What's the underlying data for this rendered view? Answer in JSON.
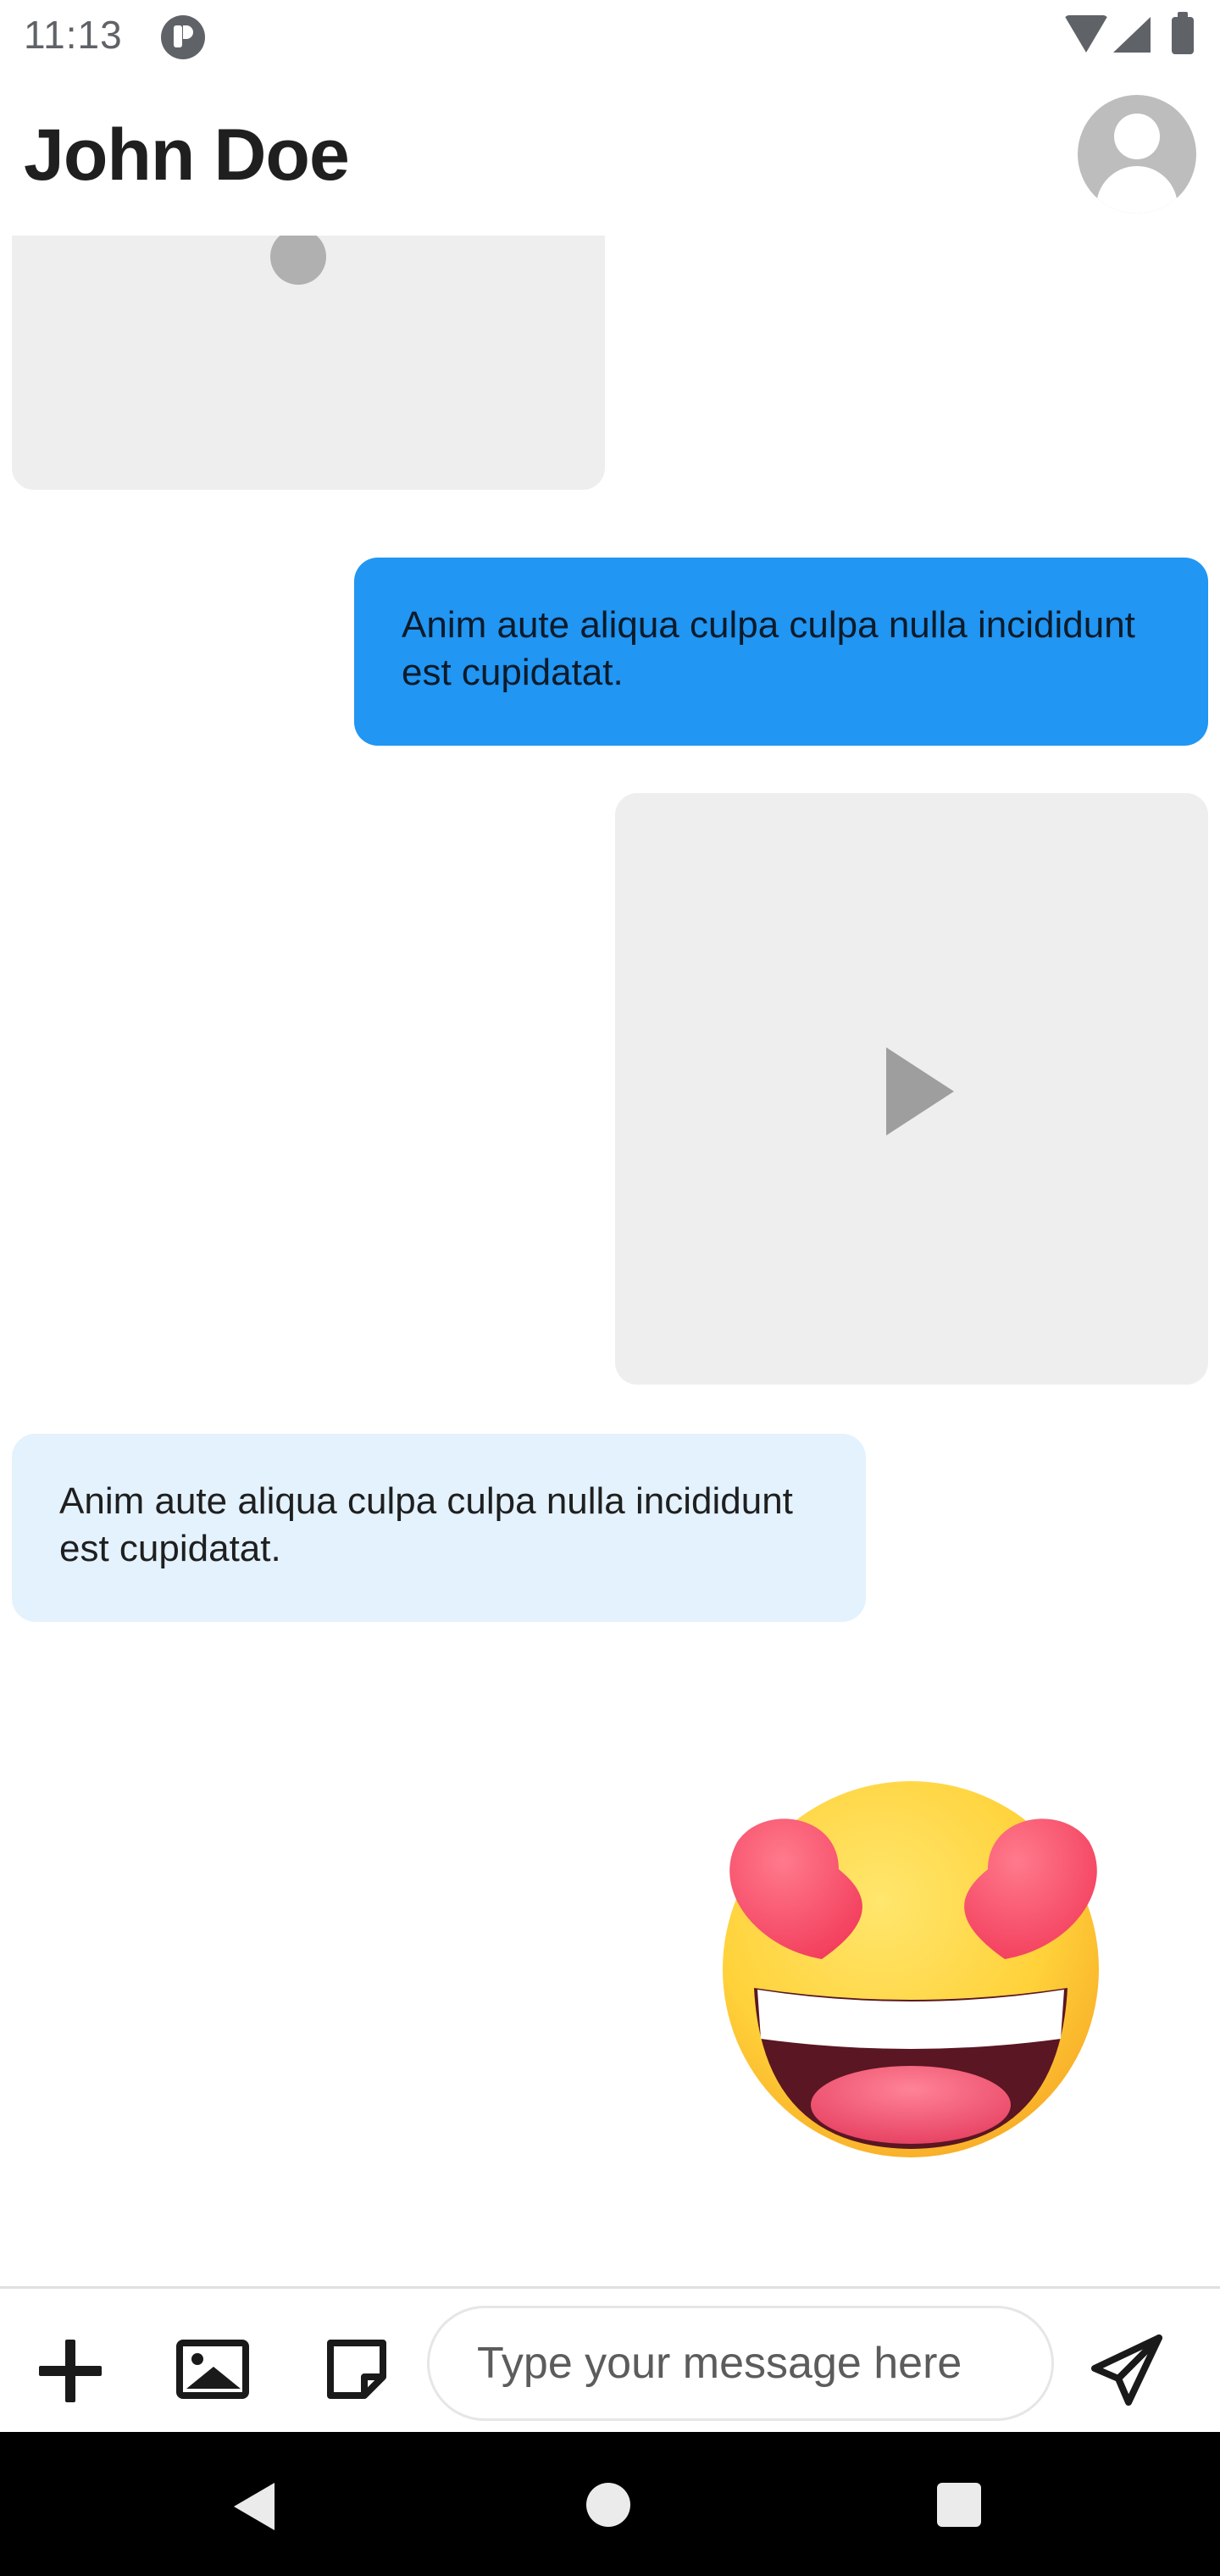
{
  "status_bar": {
    "time": "11:13",
    "icons": [
      "app-notification-icon",
      "wifi-icon",
      "signal-icon",
      "battery-icon"
    ]
  },
  "header": {
    "title": "John Doe",
    "avatar_icon": "person-icon"
  },
  "messages": [
    {
      "type": "image",
      "direction": "incoming"
    },
    {
      "type": "text",
      "direction": "outgoing",
      "text": "Anim aute aliqua culpa culpa nulla incididunt est cupidatat."
    },
    {
      "type": "video",
      "direction": "outgoing",
      "icon": "play-icon"
    },
    {
      "type": "text",
      "direction": "incoming",
      "text": "Anim aute aliqua culpa culpa nulla incididunt est cupidatat."
    },
    {
      "type": "sticker",
      "direction": "outgoing",
      "emoji": "heart-eyes-grinning-emoji"
    }
  ],
  "composer": {
    "placeholder": "Type your message here",
    "value": "",
    "icons": [
      "add-icon",
      "image-icon",
      "sticker-note-icon",
      "send-icon"
    ]
  },
  "colors": {
    "outgoing_bubble": "#2196f3",
    "incoming_bubble": "#e3f2fd",
    "media_placeholder": "#eeeeee"
  }
}
